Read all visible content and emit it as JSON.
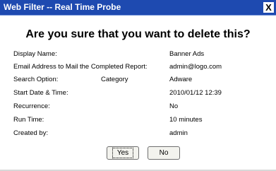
{
  "window": {
    "title": "Web Filter -- Real Time Probe",
    "close_glyph": "X"
  },
  "heading": "Are you sure that you want to delete this?",
  "details": {
    "display_name": {
      "label": "Display Name:",
      "value": "Banner Ads"
    },
    "email": {
      "label": "Email Address to Mail the Completed Report:",
      "value": "admin@logo.com"
    },
    "search_option": {
      "label": "Search Option:",
      "sub_label": "Category",
      "value": "Adware"
    },
    "start": {
      "label": "Start Date & Time:",
      "value": "2010/01/12 12:39"
    },
    "recurrence": {
      "label": "Recurrence:",
      "value": "No"
    },
    "run_time": {
      "label": "Run Time:",
      "value": "10 minutes"
    },
    "created_by": {
      "label": "Created by:",
      "value": "admin"
    }
  },
  "buttons": {
    "yes_label": "Yes",
    "no_label": "No"
  },
  "colors": {
    "titlebar": "#1e4ab0",
    "background": "#ffffff"
  }
}
